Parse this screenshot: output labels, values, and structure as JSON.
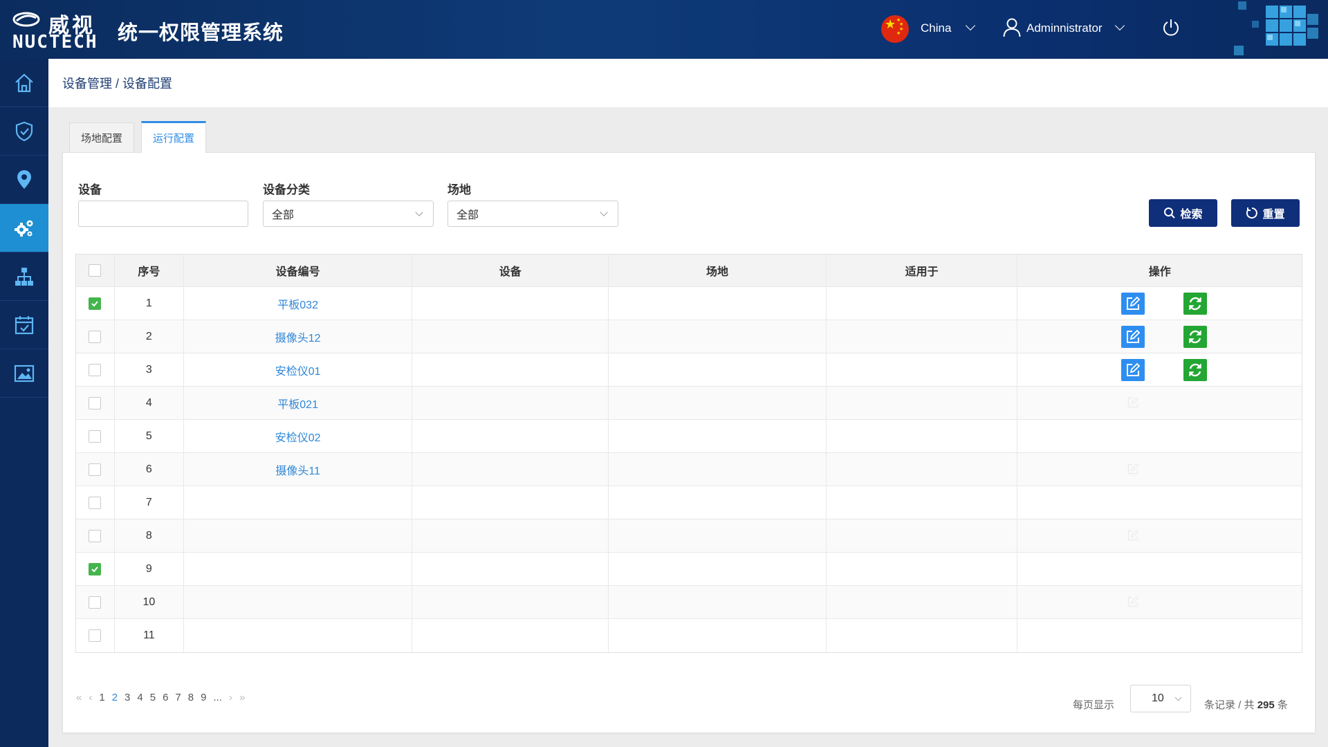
{
  "header": {
    "logo_cn": "威视",
    "logo_en": "NUCTECH",
    "system_title": "统一权限管理系统",
    "country": "China",
    "user": "Adminnistrator"
  },
  "sidebar": {
    "items": [
      {
        "icon": "home-icon",
        "active": false
      },
      {
        "icon": "shield-check-icon",
        "active": false
      },
      {
        "icon": "location-pin-icon",
        "active": false
      },
      {
        "icon": "gears-icon",
        "active": true
      },
      {
        "icon": "org-chart-icon",
        "active": false
      },
      {
        "icon": "calendar-check-icon",
        "active": false
      },
      {
        "icon": "image-icon",
        "active": false
      }
    ]
  },
  "breadcrumb": "设备管理 / 设备配置",
  "tabs": [
    {
      "label": "场地配置",
      "active": false
    },
    {
      "label": "运行配置",
      "active": true
    }
  ],
  "filters": {
    "device_label": "设备",
    "device_value": "",
    "category_label": "设备分类",
    "category_value": "全部",
    "site_label": "场地",
    "site_value": "全部",
    "search_label": "检索",
    "reset_label": "重置"
  },
  "table": {
    "columns": [
      "序号",
      "设备编号",
      "设备",
      "场地",
      "适用于",
      "操作"
    ],
    "rows": [
      {
        "checked": true,
        "index": "1",
        "code": "平板032",
        "device": "",
        "site": "",
        "applies": "",
        "actions": "full"
      },
      {
        "checked": false,
        "index": "2",
        "code": "摄像头12",
        "device": "",
        "site": "",
        "applies": "",
        "actions": "full"
      },
      {
        "checked": false,
        "index": "3",
        "code": "安检仪01",
        "device": "",
        "site": "",
        "applies": "",
        "actions": "full"
      },
      {
        "checked": false,
        "index": "4",
        "code": "平板021",
        "device": "",
        "site": "",
        "applies": "",
        "actions": "ghost"
      },
      {
        "checked": false,
        "index": "5",
        "code": "安检仪02",
        "device": "",
        "site": "",
        "applies": "",
        "actions": "none"
      },
      {
        "checked": false,
        "index": "6",
        "code": "摄像头11",
        "device": "",
        "site": "",
        "applies": "",
        "actions": "ghost"
      },
      {
        "checked": false,
        "index": "7",
        "code": "",
        "device": "",
        "site": "",
        "applies": "",
        "actions": "none"
      },
      {
        "checked": false,
        "index": "8",
        "code": "",
        "device": "",
        "site": "",
        "applies": "",
        "actions": "ghost"
      },
      {
        "checked": true,
        "index": "9",
        "code": "",
        "device": "",
        "site": "",
        "applies": "",
        "actions": "none"
      },
      {
        "checked": false,
        "index": "10",
        "code": "",
        "device": "",
        "site": "",
        "applies": "",
        "actions": "ghost"
      },
      {
        "checked": false,
        "index": "11",
        "code": "",
        "device": "",
        "site": "",
        "applies": "",
        "actions": "none"
      }
    ]
  },
  "pagination": {
    "first": "«",
    "prev": "‹",
    "pages": [
      "1",
      "2",
      "3",
      "4",
      "5",
      "6",
      "7",
      "8",
      "9"
    ],
    "current": "2",
    "ellipsis": "...",
    "next": "›",
    "last": "»",
    "per_page_label": "每页显示",
    "page_size": "10",
    "records_label": "条记录 / 共",
    "total": "295",
    "total_unit": "条"
  },
  "colors": {
    "header_bg": "#0e3b78",
    "sidebar_bg": "#0c2a5c",
    "sidebar_active": "#1d8fd2",
    "primary_button": "#102f7a",
    "link": "#2f87d8",
    "edit_button": "#2e8ef0",
    "refresh_button": "#23a633",
    "checkbox_on": "#44b54c"
  }
}
